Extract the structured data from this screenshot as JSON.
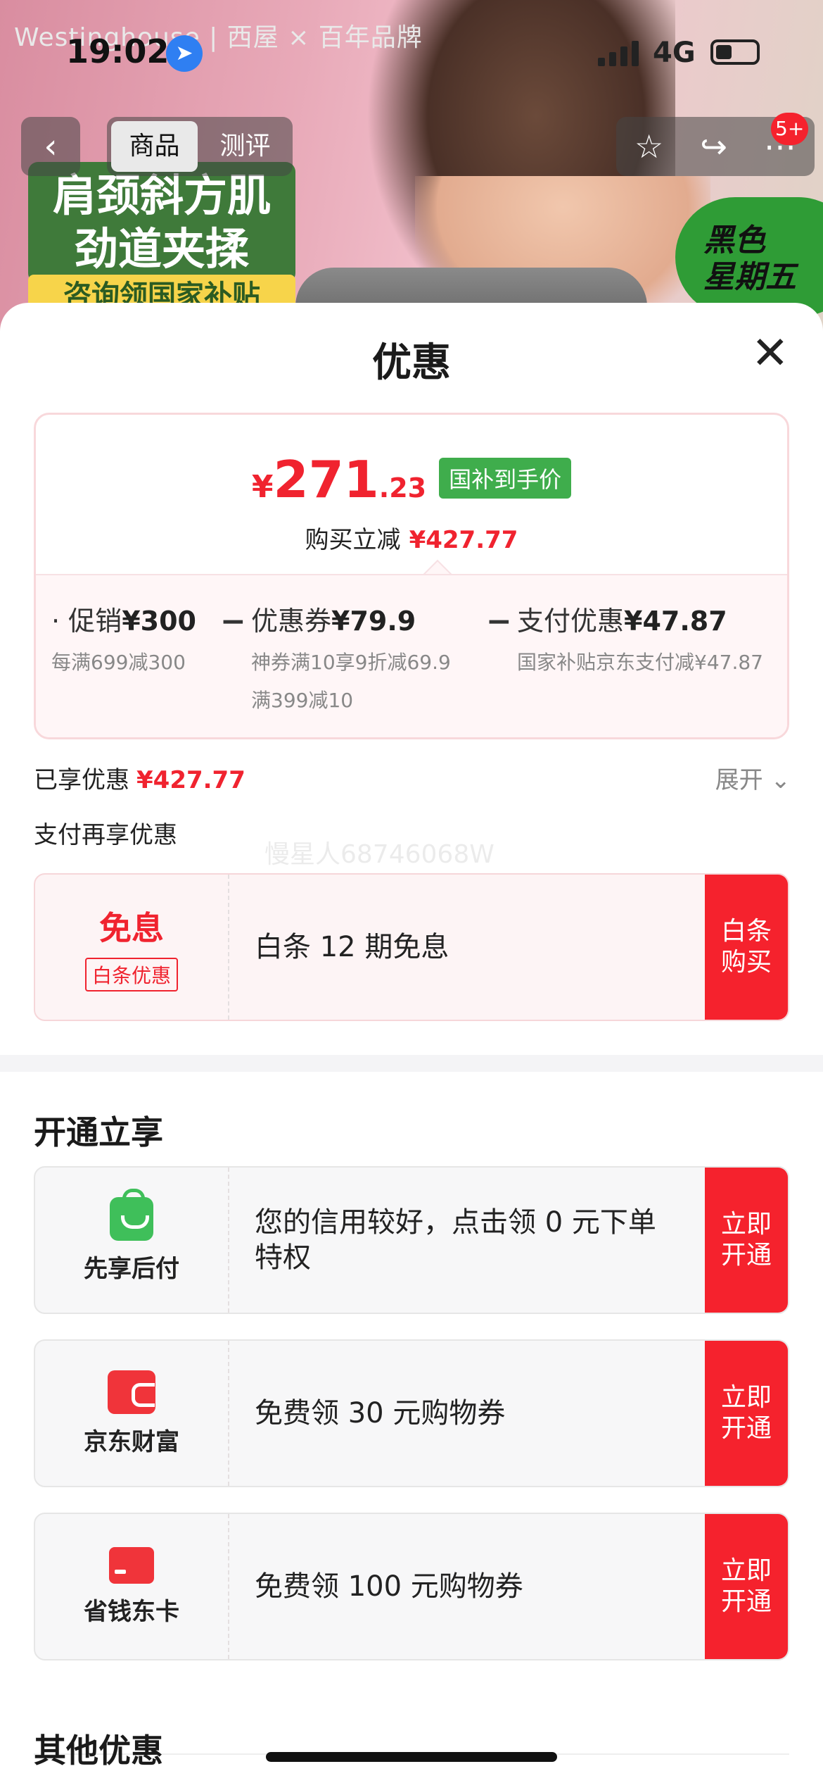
{
  "status_bar": {
    "time": "19:02",
    "network": "4G"
  },
  "hero": {
    "brand": "Westinghouse | 西屋 × 百年品牌",
    "banner_lines": [
      "肩颈斜方肌",
      "劲道夹揉"
    ],
    "banner_sub": "咨询领国家补贴",
    "sticker_lines": [
      "黑色",
      "星期五"
    ]
  },
  "nav": {
    "tabs": [
      "商品",
      "测评"
    ],
    "active_tab": "商品",
    "badge": "5+"
  },
  "sheet": {
    "title": "优惠",
    "price_card": {
      "currency": "¥",
      "price_int": "271",
      "price_dec": ".23",
      "price_tag": "国补到手价",
      "reduce_label": "购买立减",
      "reduce_amount": "¥427.77",
      "items": [
        {
          "label": "促销",
          "value": "¥300",
          "desc": [
            "每满699减300"
          ]
        },
        {
          "label": "优惠券",
          "value": "¥79.9",
          "desc": [
            "神券满10享9折减69.9",
            "满399减10"
          ]
        },
        {
          "label": "支付优惠",
          "value": "¥47.87",
          "desc": [
            "国家补贴京东支付减¥47.87"
          ]
        }
      ]
    },
    "enjoyed_label": "已享优惠",
    "enjoyed_amount": "¥427.77",
    "expand_label": "展开",
    "pay_more_label": "支付再享优惠",
    "watermark": "慢星人68746068W",
    "baitiao": {
      "big": "免息",
      "small": "白条优惠",
      "text": "白条 12 期免息",
      "cta": "白条购买"
    },
    "open_section_title": "开通立享",
    "open_offers": [
      {
        "icon": "bag-icon",
        "label": "先享后付",
        "text": "您的信用较好，点击领 0 元下单特权",
        "cta": "立即开通"
      },
      {
        "icon": "wallet-icon",
        "label": "京东财富",
        "text": "免费领 30 元购物券",
        "cta": "立即开通"
      },
      {
        "icon": "card-icon",
        "label": "省钱东卡",
        "text": "免费领 100 元购物券",
        "cta": "立即开通"
      }
    ],
    "other_section_title": "其他优惠"
  },
  "colors": {
    "accent_red": "#f5222d",
    "price_red": "#f0232f",
    "tag_green": "#3fad4c"
  }
}
